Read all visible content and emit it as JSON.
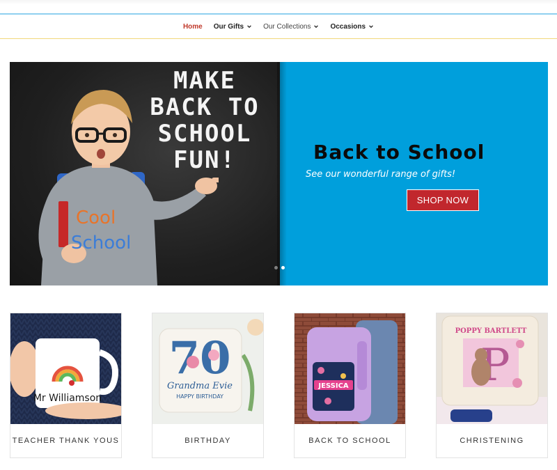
{
  "nav": {
    "items": [
      {
        "label": "Home",
        "active": true,
        "dropdown": false
      },
      {
        "label": "Our Gifts",
        "active": false,
        "dropdown": true
      },
      {
        "label": "Our Collections",
        "active": false,
        "dropdown": true
      },
      {
        "label": "Occasions",
        "active": false,
        "dropdown": true
      }
    ]
  },
  "hero": {
    "chalk_lines": [
      "MAKE",
      "BACK TO",
      "SCHOOL",
      "FUN!"
    ],
    "title": "Back to School",
    "subtitle": "See our wonderful range of gifts!",
    "cta_label": "SHOP NOW",
    "slides": 2,
    "active_slide": 2,
    "colors": {
      "panel": "#009fdc",
      "cta": "#c1272d"
    }
  },
  "categories": [
    {
      "label": "TEACHER THANK YOUS",
      "mug_text": "Mr Williamson"
    },
    {
      "label": "BIRTHDAY",
      "cushion_number": "70",
      "cushion_name": "Grandma Evie",
      "cushion_line": "HAPPY BIRTHDAY"
    },
    {
      "label": "BACK TO SCHOOL",
      "bag_name": "JESSICA"
    },
    {
      "label": "CHRISTENING",
      "cushion_title": "POPPY BARTLETT",
      "cushion_letter": "P"
    }
  ],
  "colors": {
    "active_nav": "#c0392b",
    "accent_line": "#8fd0ef"
  }
}
